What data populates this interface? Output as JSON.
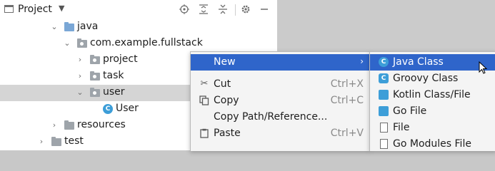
{
  "panel": {
    "title": "Project",
    "icons": [
      "locate-icon",
      "expand-all-icon",
      "collapse-all-icon",
      "gear-icon",
      "minimize-icon"
    ]
  },
  "tree": {
    "items": [
      {
        "label": "java",
        "icon": "source-folder-icon",
        "expanded": true
      },
      {
        "label": "com.example.fullstack",
        "icon": "package-icon",
        "expanded": true
      },
      {
        "label": "project",
        "icon": "package-icon",
        "expanded": false
      },
      {
        "label": "task",
        "icon": "package-icon",
        "expanded": false
      },
      {
        "label": "user",
        "icon": "package-icon",
        "expanded": true,
        "selected": true
      },
      {
        "label": "User",
        "icon": "java-class-icon"
      },
      {
        "label": "resources",
        "icon": "resources-folder-icon",
        "expanded": false
      },
      {
        "label": "test",
        "icon": "folder-icon",
        "expanded": false
      }
    ]
  },
  "context_menu": {
    "items": [
      {
        "label": "New",
        "shortcut": "",
        "submenu": true
      },
      {
        "label": "Cut",
        "shortcut": "Ctrl+X",
        "icon": "scissors-icon"
      },
      {
        "label": "Copy",
        "shortcut": "Ctrl+C",
        "icon": "copy-icon"
      },
      {
        "label": "Copy Path/Reference...",
        "shortcut": ""
      },
      {
        "label": "Paste",
        "shortcut": "Ctrl+V",
        "icon": "paste-icon"
      }
    ]
  },
  "submenu": {
    "items": [
      {
        "label": "Java Class",
        "icon": "java-class-icon"
      },
      {
        "label": "Groovy Class",
        "icon": "groovy-class-icon"
      },
      {
        "label": "Kotlin Class/File",
        "icon": "kotlin-file-icon"
      },
      {
        "label": "Go File",
        "icon": "go-file-icon"
      },
      {
        "label": "File",
        "icon": "file-icon"
      },
      {
        "label": "Go Modules File",
        "icon": "go-modules-file-icon"
      }
    ]
  },
  "colors": {
    "selection_active": "#2f65ca",
    "tree_selected": "#d5d5d5",
    "class_icon": "#3d9ed8"
  }
}
